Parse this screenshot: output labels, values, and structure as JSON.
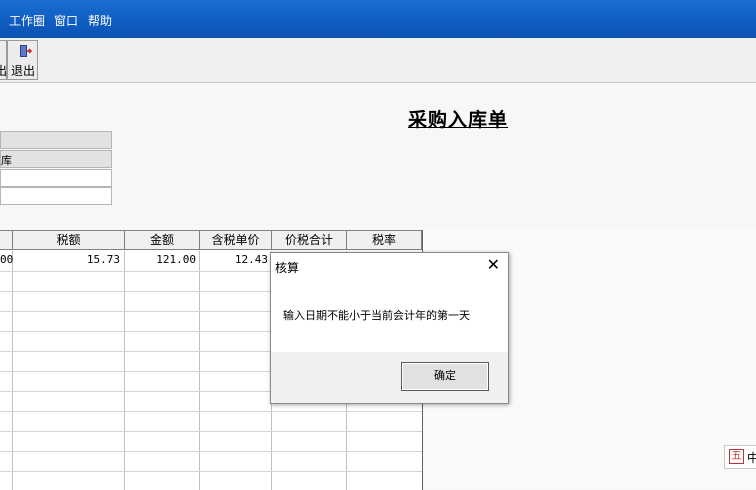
{
  "menu": [
    "工作圈",
    "窗口",
    "帮助"
  ],
  "toolbar": {
    "exit_label": "退出",
    "left_partial_label": "出"
  },
  "form": {
    "title": "采购入库单",
    "field_partial": "库"
  },
  "grid": {
    "headers": [
      "税额",
      "金额",
      "含税单价",
      "价税合计",
      "税率"
    ],
    "row1": {
      "partial": "00",
      "tax": "15.73",
      "amount": "121.00",
      "unit_price": "12.43"
    }
  },
  "dialog": {
    "title": "核算",
    "close_icon": "close-icon",
    "message": "输入日期不能小于当前会计年的第一天",
    "ok_label": "确定"
  },
  "ime": {
    "symbol": "五",
    "text": "中"
  },
  "colors": {
    "menubar": "#1565c8",
    "dialog_bg": "#f0f0f0"
  }
}
